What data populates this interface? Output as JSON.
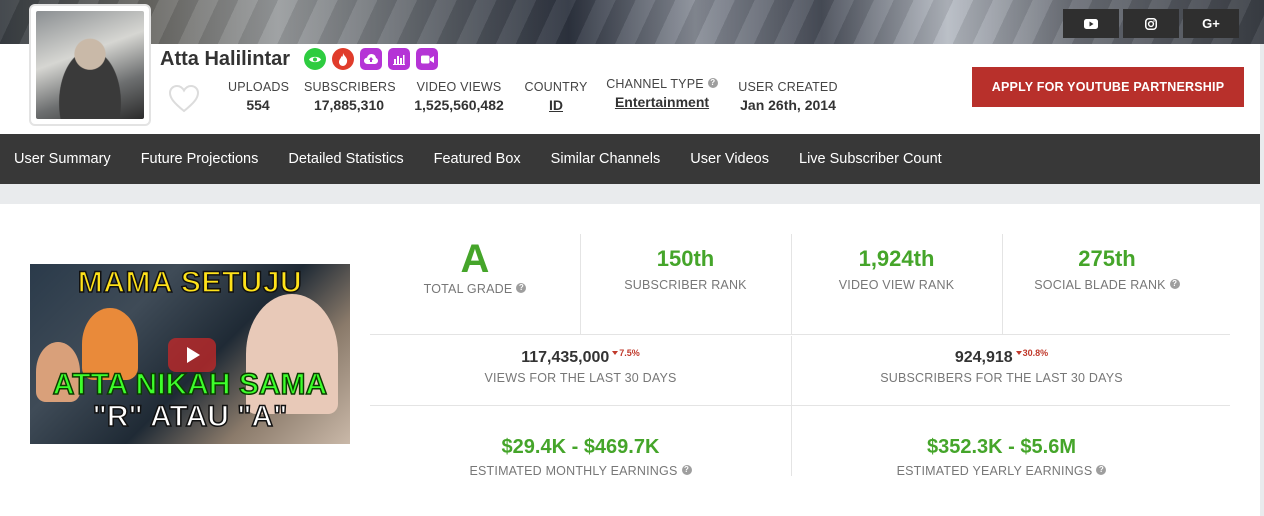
{
  "social": {
    "youtube_icon": "youtube-icon",
    "instagram_icon": "instagram-icon",
    "googleplus_label": "G+"
  },
  "channel": {
    "name": "Atta Halilintar",
    "stats": [
      {
        "label": "UPLOADS",
        "value": "554"
      },
      {
        "label": "SUBSCRIBERS",
        "value": "17,885,310"
      },
      {
        "label": "VIDEO VIEWS",
        "value": "1,525,560,482"
      },
      {
        "label": "COUNTRY",
        "value": "ID"
      },
      {
        "label": "CHANNEL TYPE",
        "value": "Entertainment"
      },
      {
        "label": "USER CREATED",
        "value": "Jan 26th, 2014"
      }
    ],
    "apply_button": "APPLY FOR YOUTUBE PARTNERSHIP",
    "help_mark": "?"
  },
  "nav": {
    "items": [
      "User Summary",
      "Future Projections",
      "Detailed Statistics",
      "Featured Box",
      "Similar Channels",
      "User Videos",
      "Live Subscriber Count"
    ]
  },
  "thumbnail": {
    "line1": "MAMA SETUJU",
    "line2": "ATTA NIKAH SAMA",
    "line3": "\"R\" ATAU \"A\""
  },
  "summary": {
    "grade": {
      "value": "A",
      "label": "TOTAL GRADE"
    },
    "subscriber_rank": {
      "value": "150th",
      "label": "SUBSCRIBER RANK"
    },
    "video_view_rank": {
      "value": "1,924th",
      "label": "VIDEO VIEW RANK"
    },
    "social_blade_rank": {
      "value": "275th",
      "label": "SOCIAL BLADE RANK"
    },
    "views_30": {
      "value": "117,435,000",
      "delta": "7.5%",
      "label": "VIEWS FOR THE LAST 30 DAYS"
    },
    "subs_30": {
      "value": "924,918",
      "delta": "30.8%",
      "label": "SUBSCRIBERS FOR THE LAST 30 DAYS"
    },
    "monthly": {
      "value": "$29.4K - $469.7K",
      "label": "ESTIMATED MONTHLY EARNINGS"
    },
    "yearly": {
      "value": "$352.3K - $5.6M",
      "label": "ESTIMATED YEARLY EARNINGS"
    }
  },
  "colors": {
    "accent_green": "#45a52a",
    "apply_red": "#b8302b",
    "nav_bg": "#383838",
    "delta_red": "#c0392b"
  }
}
